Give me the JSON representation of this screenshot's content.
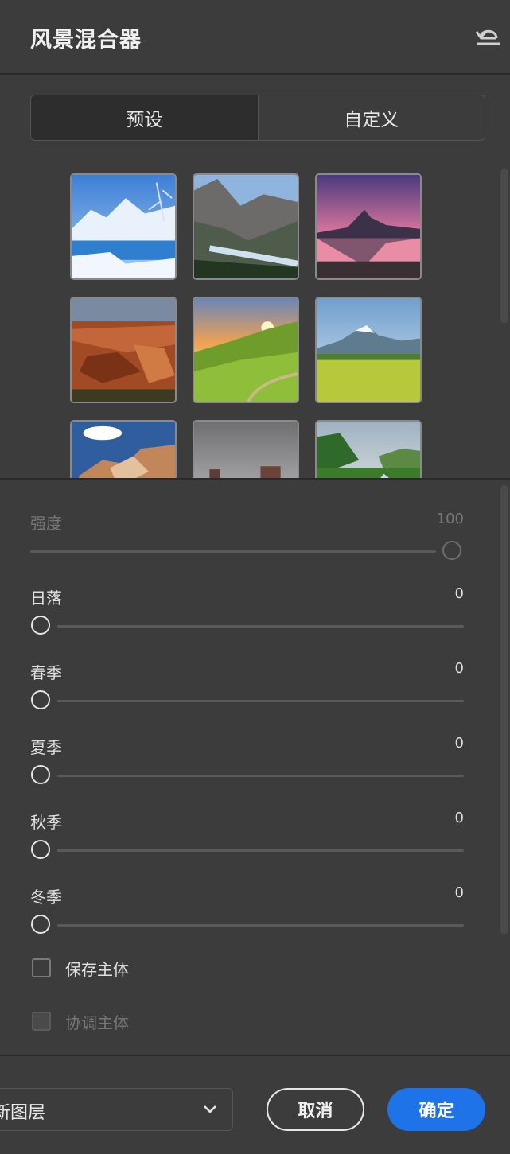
{
  "header": {
    "title": "风景混合器",
    "reset_icon": "undo-icon"
  },
  "tabs": [
    {
      "label": "预设",
      "active": true
    },
    {
      "label": "自定义",
      "active": false
    }
  ],
  "presets": [
    {
      "scene": "snowy-lake"
    },
    {
      "scene": "mountain-valley"
    },
    {
      "scene": "pink-sunset-peak"
    },
    {
      "scene": "canyon"
    },
    {
      "scene": "sunrise-hills"
    },
    {
      "scene": "green-meadow"
    },
    {
      "scene": "desert-rocks"
    },
    {
      "scene": "grey-mesa"
    },
    {
      "scene": "river-valley"
    }
  ],
  "sliders": {
    "strength": {
      "label": "强度",
      "value": "100",
      "disabled": true
    },
    "sunset": {
      "label": "日落",
      "value": "0"
    },
    "spring": {
      "label": "春季",
      "value": "0"
    },
    "summer": {
      "label": "夏季",
      "value": "0"
    },
    "autumn": {
      "label": "秋季",
      "value": "0"
    },
    "winter": {
      "label": "冬季",
      "value": "0"
    }
  },
  "checkboxes": {
    "keep_subject": {
      "label": "保存主体",
      "checked": false,
      "disabled": false
    },
    "harmonize_subject": {
      "label": "协调主体",
      "checked": false,
      "disabled": true
    }
  },
  "footer": {
    "output_select": "新图层",
    "cancel_label": "取消",
    "ok_label": "确定"
  },
  "colors": {
    "accent": "#1e73e8",
    "background": "#3c3c3c"
  }
}
